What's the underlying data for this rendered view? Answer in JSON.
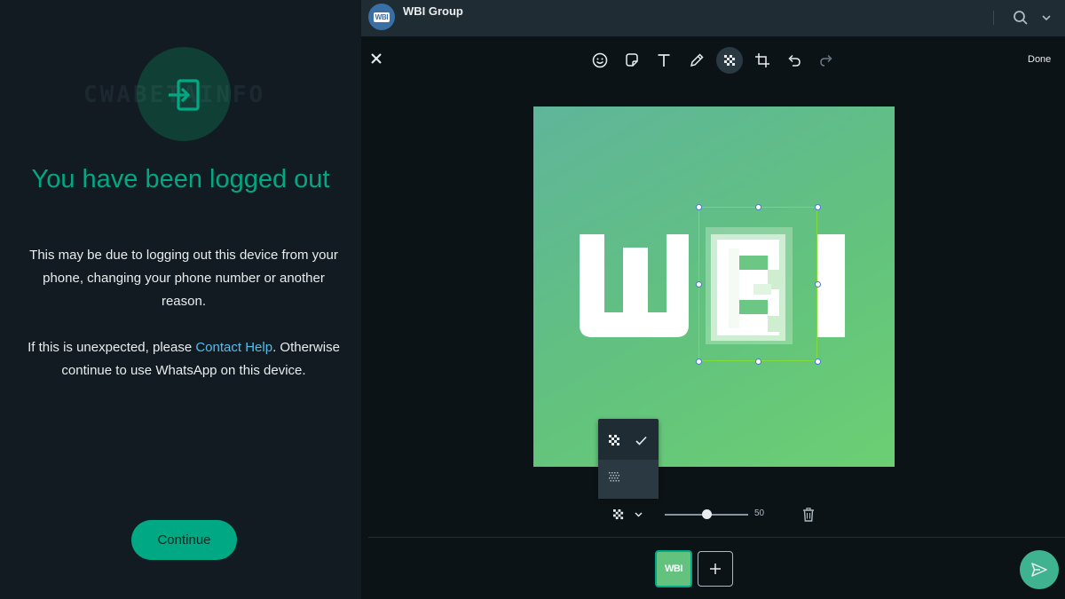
{
  "logout": {
    "watermark": "CWABETAINFO",
    "title": "You have been logged out",
    "paragraph1": "This may be due to logging out this device from your phone, changing your phone number or another reason.",
    "paragraph2_before": "If this is unexpected, please ",
    "paragraph2_link": "Contact Help",
    "paragraph2_after": ". Otherwise continue to use WhatsApp on this device.",
    "continue_label": "Continue"
  },
  "chat": {
    "avatar_text": "WBI",
    "group_name": "WBI Group"
  },
  "editor": {
    "done_label": "Done",
    "image_text": "WBI",
    "tools": [
      "emoji-icon",
      "sticker-icon",
      "text-icon",
      "pencil-icon",
      "pixelate-icon",
      "crop-icon",
      "undo-icon",
      "redo-icon"
    ],
    "active_tool": "pixelate-icon",
    "blur_options": [
      "pixelate-large-icon",
      "pixelate-fine-icon"
    ],
    "selected_blur": "pixelate-large-icon",
    "blur_strength": 50,
    "blur_strength_label": "50",
    "thumbnail_text": "WBI"
  },
  "colors": {
    "accent": "#00a884",
    "link": "#53bdeb",
    "selection": "#7fdc3a"
  }
}
